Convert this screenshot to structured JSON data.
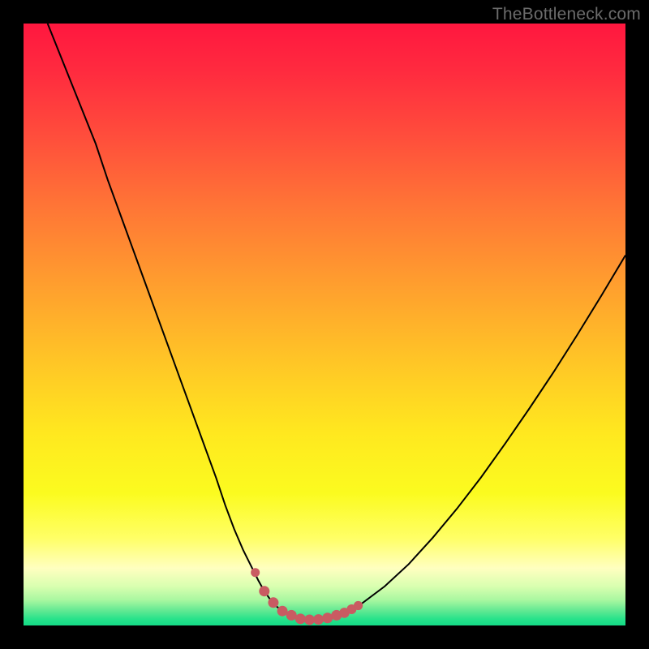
{
  "watermark": "TheBottleneck.com",
  "colors": {
    "frame": "#000000",
    "curve_stroke": "#000000",
    "marker_fill": "#c95b62",
    "gradient_stops": [
      {
        "offset": 0.0,
        "color": "#ff173f"
      },
      {
        "offset": 0.08,
        "color": "#ff2b3f"
      },
      {
        "offset": 0.18,
        "color": "#ff4b3c"
      },
      {
        "offset": 0.3,
        "color": "#ff7436"
      },
      {
        "offset": 0.42,
        "color": "#ff9a2f"
      },
      {
        "offset": 0.55,
        "color": "#ffc227"
      },
      {
        "offset": 0.68,
        "color": "#ffe81f"
      },
      {
        "offset": 0.78,
        "color": "#fbfb1f"
      },
      {
        "offset": 0.855,
        "color": "#ffff66"
      },
      {
        "offset": 0.905,
        "color": "#ffffc0"
      },
      {
        "offset": 0.935,
        "color": "#d9ffb0"
      },
      {
        "offset": 0.958,
        "color": "#a8f7a0"
      },
      {
        "offset": 0.975,
        "color": "#63e993"
      },
      {
        "offset": 0.99,
        "color": "#25e28a"
      },
      {
        "offset": 1.0,
        "color": "#15db86"
      }
    ]
  },
  "chart_data": {
    "type": "line",
    "title": "",
    "xlabel": "",
    "ylabel": "",
    "xlim": [
      0,
      100
    ],
    "ylim": [
      0,
      100
    ],
    "series": [
      {
        "name": "bottleneck-curve",
        "x": [
          4,
          6,
          8,
          10,
          12,
          14,
          16,
          18,
          20,
          22,
          24,
          26,
          28,
          30,
          32,
          33.5,
          35,
          36.5,
          38,
          39,
          40,
          41,
          42,
          43,
          44,
          45,
          46,
          47.5,
          49,
          51,
          53,
          56,
          60,
          64,
          68,
          72,
          76,
          80,
          84,
          88,
          92,
          96,
          100
        ],
        "y": [
          100,
          95,
          90,
          85,
          80,
          74,
          68.5,
          63,
          57.5,
          52,
          46.5,
          41,
          35.5,
          30,
          24.5,
          20,
          16,
          12.5,
          9.5,
          7.5,
          5.7,
          4.3,
          3.2,
          2.4,
          1.8,
          1.4,
          1.1,
          0.95,
          1.0,
          1.3,
          2.0,
          3.5,
          6.5,
          10.2,
          14.6,
          19.4,
          24.6,
          30.2,
          36.0,
          42.0,
          48.3,
          54.8,
          61.5
        ]
      }
    ],
    "markers": {
      "name": "highlighted-points",
      "x": [
        38.5,
        40.0,
        41.5,
        43.0,
        44.5,
        46.0,
        47.5,
        49.0,
        50.5,
        52.0,
        53.3,
        54.5,
        55.6
      ],
      "y": [
        8.8,
        5.7,
        3.8,
        2.4,
        1.7,
        1.1,
        0.95,
        1.0,
        1.25,
        1.7,
        2.1,
        2.7,
        3.3
      ],
      "r": [
        5.5,
        6.5,
        6.5,
        6.5,
        6.5,
        6.5,
        6.5,
        6.5,
        6.5,
        6.5,
        6.3,
        6.0,
        5.6
      ]
    }
  }
}
